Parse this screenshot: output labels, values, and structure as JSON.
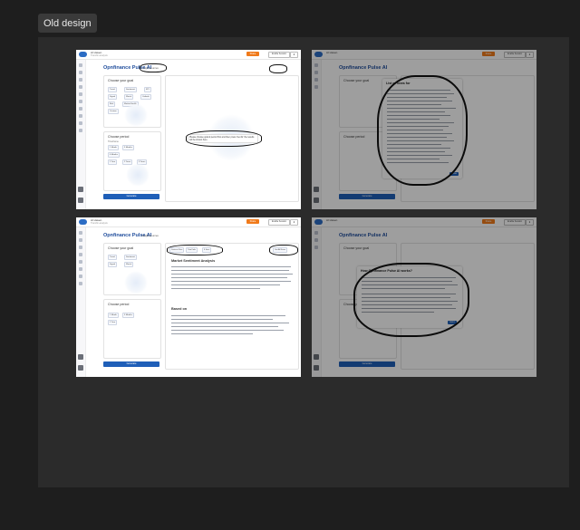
{
  "frame": {
    "label": "Old design"
  },
  "app": {
    "org_name": "AI Haven",
    "org_sub": "Transfin-analysis",
    "page_title": "Opnfinance Pulse AI",
    "sub_link": "Insight sources",
    "topbar_orange": "Share",
    "topbar_white": "Enable Session",
    "topbar_num": "2"
  },
  "left": {
    "goal_heading": "Choose your goal",
    "goal_chips": [
      "Trend",
      "Sentiment",
      "KPI",
      "Signal",
      "Watch",
      "Outlook",
      "Risk",
      "Market Health",
      "Custom"
    ],
    "period_heading": "Choose period",
    "period_sub": "Timeframe",
    "period_chips": [
      "1 Month",
      "3 Months",
      "6 Months",
      "1 Year",
      "2 Years",
      "5 Years"
    ],
    "goal_button": "Generate"
  },
  "screens": {
    "s1": {
      "note": "Please choose goal & period first and then press 'Get AI' the results will be shown here"
    },
    "s2": {
      "modal_title": "List of news for",
      "ok": "Close"
    },
    "s3": {
      "pills": [
        "Dataset Size",
        "Total Info",
        "6 lines"
      ],
      "section1_title": "Market Sentiment Analysis",
      "section2_title": "Based on",
      "right_btn": "Get AI News"
    },
    "s4": {
      "modal_title": "How Opnfinance Pulse AI works?",
      "ok": "Got it"
    }
  },
  "colors": {
    "brand_blue": "#1f5fb8",
    "accent_orange": "#f07a1a",
    "title_blue": "#1f4d9c",
    "canvas": "#1e1e1e",
    "board": "#2b2b2b"
  }
}
